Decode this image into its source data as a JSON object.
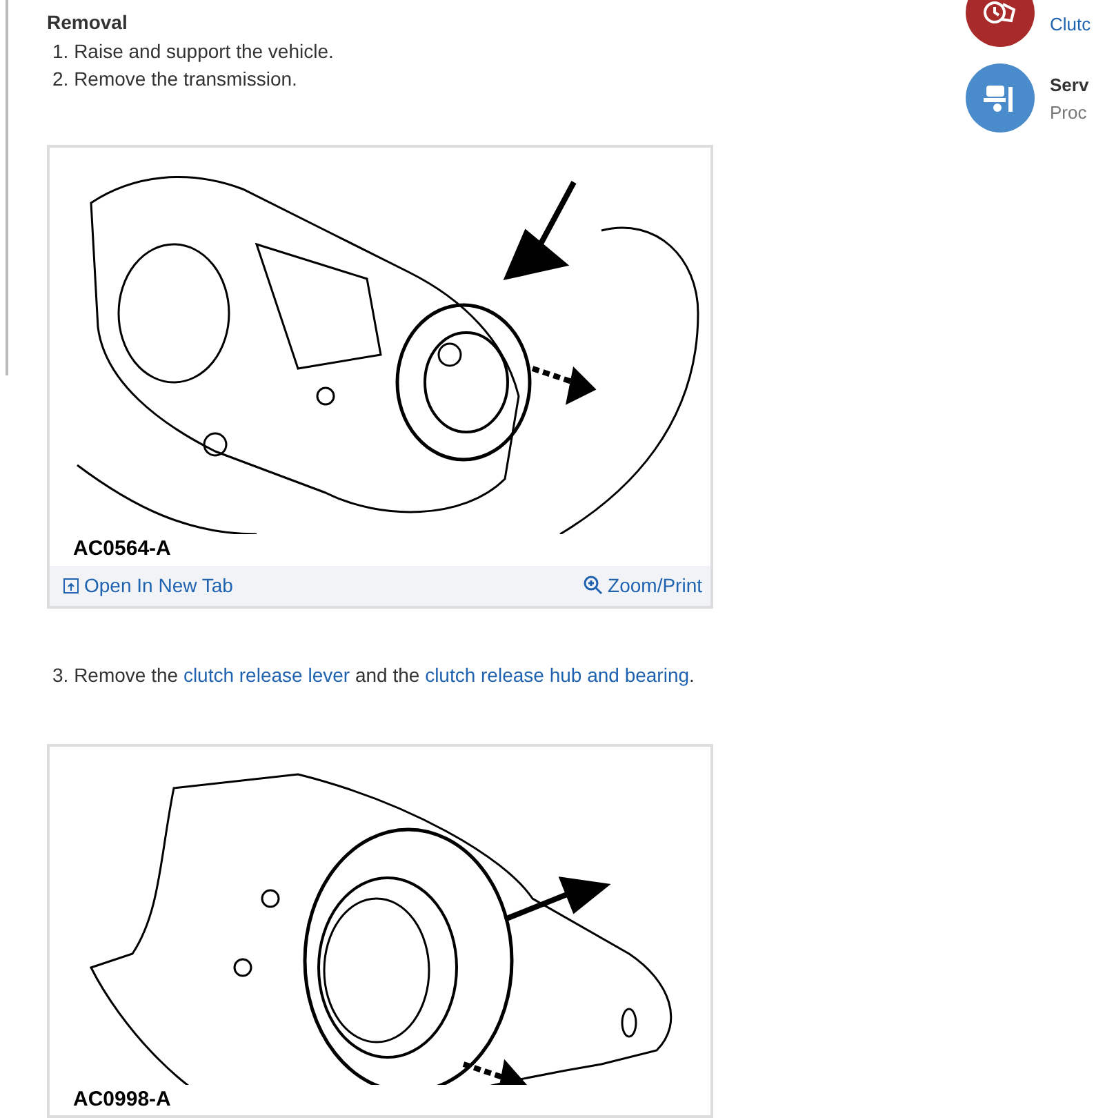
{
  "section_title": "Removal",
  "content": [
    {
      "kind": "step",
      "number": "1.",
      "parts": [
        {
          "kind": "text",
          "text": "Raise and support the vehicle."
        }
      ]
    },
    {
      "kind": "step",
      "number": "2.",
      "parts": [
        {
          "kind": "text",
          "text": "Remove the transmission."
        }
      ]
    },
    {
      "kind": "figure",
      "caption": "AC0564-A",
      "open_link": "Open In New Tab",
      "zoom_link": "Zoom/Print"
    },
    {
      "kind": "step",
      "number": "3.",
      "parts": [
        {
          "kind": "text",
          "text": "Remove the "
        },
        {
          "kind": "link",
          "text": "clutch release lever"
        },
        {
          "kind": "text",
          "text": " and the "
        },
        {
          "kind": "link",
          "text": "clutch release hub and bearing"
        },
        {
          "kind": "text",
          "text": "."
        }
      ]
    },
    {
      "kind": "figure",
      "caption": "AC0998-A"
    }
  ],
  "side_links": [
    {
      "kind": "part",
      "color": "#a82a2a",
      "subtitle": "Clutc"
    },
    {
      "kind": "service",
      "color": "#4a8bcb",
      "title": "Serv",
      "subtitle": "Proc"
    }
  ]
}
